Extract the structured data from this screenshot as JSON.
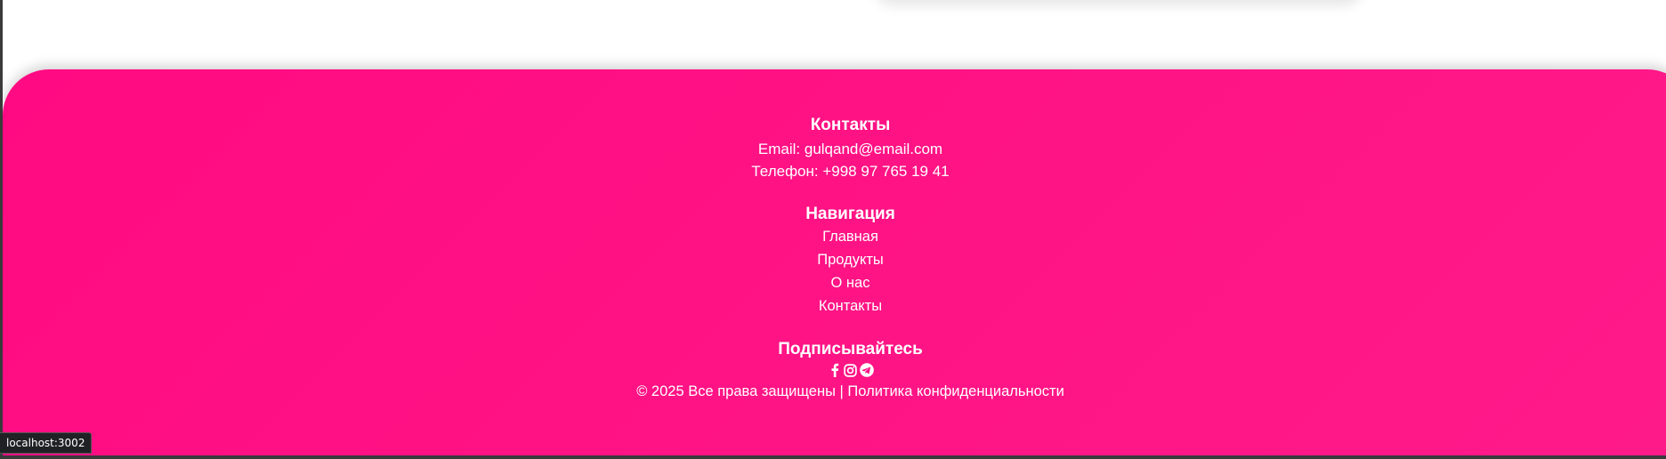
{
  "footer": {
    "contacts": {
      "heading": "Контакты",
      "email": "Email: gulqand@email.com",
      "phone": "Телефон: +998 97 765 19 41"
    },
    "navigation": {
      "heading": "Навигация",
      "items": [
        {
          "label": "Главная"
        },
        {
          "label": "Продукты"
        },
        {
          "label": "О нас"
        },
        {
          "label": "Контакты"
        }
      ]
    },
    "subscribe": {
      "heading": "Подписывайтесь",
      "icons": [
        "facebook-icon",
        "instagram-icon",
        "telegram-icon"
      ]
    },
    "copyright": "© 2025 Все права защищены | Политика конфиденциальности"
  },
  "status_bar": {
    "url": "localhost:3002"
  },
  "colors": {
    "footer_bg": "#ff0a82",
    "text": "#ffffff"
  }
}
